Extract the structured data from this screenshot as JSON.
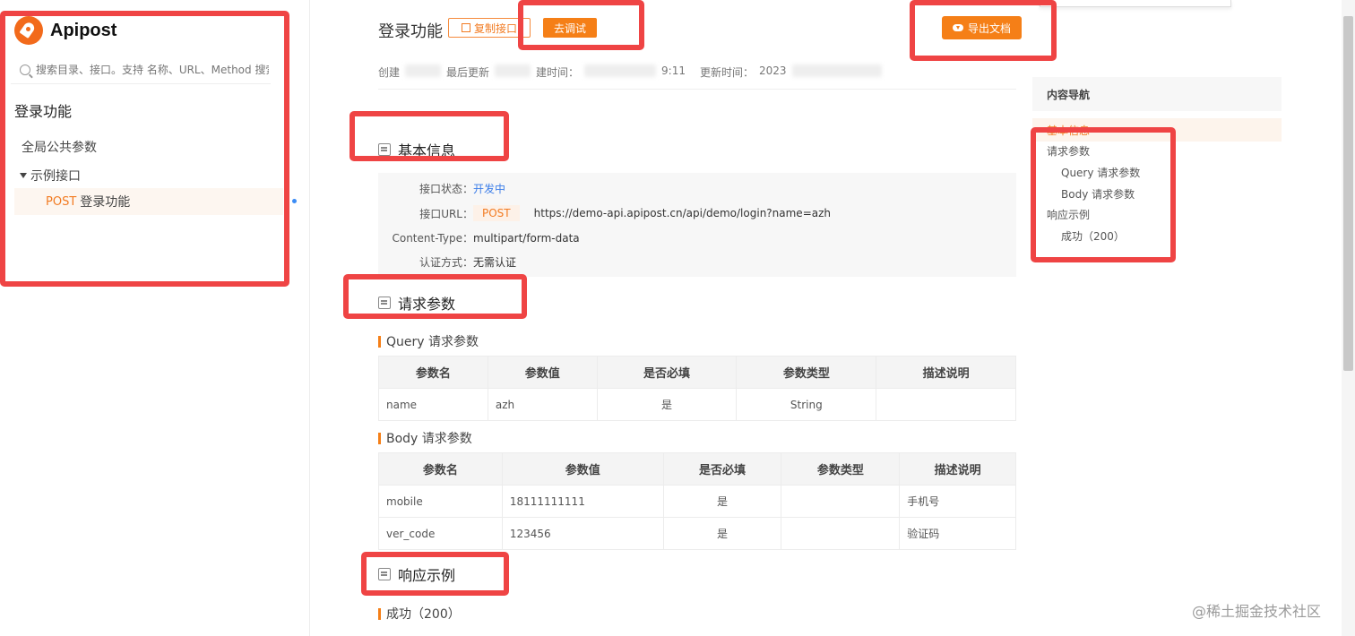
{
  "app": {
    "name": "Apipost"
  },
  "sidebar": {
    "search_placeholder": "搜索目录、接口。支持 名称、URL、Method 搜索",
    "project_title": "登录功能",
    "global_params": "全局公共参数",
    "folder": "示例接口",
    "api_method": "POST",
    "api_name": "登录功能"
  },
  "header": {
    "title": "登录功能",
    "copy_button": "复制接口",
    "debug_button": "去调试",
    "export_button": "导出文档"
  },
  "meta": {
    "created_label": "创建",
    "last_updated_label": "最后更新",
    "created_time_label": "建时间：",
    "created_time_tail": "9:11",
    "updated_time_label": "更新时间：",
    "updated_time_value": "2023"
  },
  "basic_info": {
    "section_title": "基本信息",
    "status_label": "接口状态：",
    "status_value": "开发中",
    "url_label": "接口URL：",
    "url_method": "POST",
    "url_value": "https://demo-api.apipost.cn/api/demo/login?name=azh",
    "content_type_label": "Content-Type：",
    "content_type_value": "multipart/form-data",
    "auth_label": "认证方式：",
    "auth_value": "无需认证"
  },
  "request_params": {
    "section_title": "请求参数",
    "query": {
      "title": "Query 请求参数",
      "headers": [
        "参数名",
        "参数值",
        "是否必填",
        "参数类型",
        "描述说明"
      ],
      "rows": [
        [
          "name",
          "azh",
          "是",
          "String",
          ""
        ]
      ]
    },
    "body": {
      "title": "Body 请求参数",
      "headers": [
        "参数名",
        "参数值",
        "是否必填",
        "参数类型",
        "描述说明"
      ],
      "rows": [
        [
          "mobile",
          "18111111111",
          "是",
          "",
          "手机号"
        ],
        [
          "ver_code",
          "123456",
          "是",
          "",
          "验证码"
        ]
      ]
    }
  },
  "response": {
    "section_title": "响应示例",
    "success_title": "成功（200）"
  },
  "right_nav": {
    "title": "内容导航",
    "active": "基本信息",
    "items": [
      "请求参数",
      "Query 请求参数",
      "Body 请求参数",
      "响应示例",
      "成功（200）"
    ]
  },
  "watermark": "@稀土掘金技术社区",
  "colors": {
    "accent": "#f57f17",
    "annotation": "#ef4444",
    "link": "#3b7de8"
  }
}
